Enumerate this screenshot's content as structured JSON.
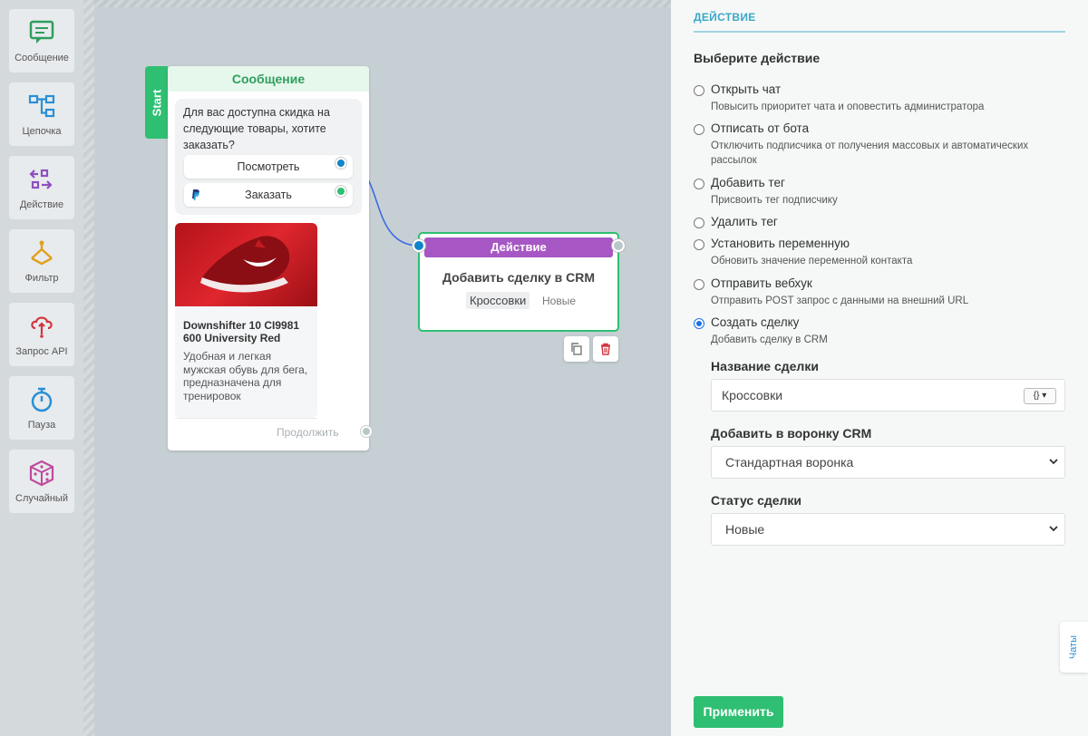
{
  "toolbar": {
    "items": [
      {
        "label": "Сообщение",
        "icon": "message-icon"
      },
      {
        "label": "Цепочка",
        "icon": "chain-icon"
      },
      {
        "label": "Действие",
        "icon": "action-icon"
      },
      {
        "label": "Фильтр",
        "icon": "filter-icon"
      },
      {
        "label": "Запрос API",
        "icon": "api-request-icon"
      },
      {
        "label": "Пауза",
        "icon": "pause-timer-icon"
      },
      {
        "label": "Случайный",
        "icon": "dice-icon"
      }
    ]
  },
  "message_node": {
    "start_label": "Start",
    "title": "Сообщение",
    "text": "Для вас доступна скидка на следующие товары, хотите заказать?",
    "buttons": [
      {
        "label": "Посмотреть"
      },
      {
        "label": "Заказать"
      }
    ],
    "card": {
      "title": "Downshifter 10 CI9981 600 University Red",
      "description": "Удобная и легкая мужская обувь для бега, предназначена для тренировок"
    },
    "continue_label": "Продолжить"
  },
  "action_node": {
    "header": "Действие",
    "title": "Добавить сделку в CRM",
    "deal_name": "Кроссовки",
    "status": "Новые"
  },
  "panel": {
    "header": "ДЕЙСТВИЕ",
    "section_title": "Выберите действие",
    "options": [
      {
        "title": "Открыть чат",
        "desc": "Повысить приоритет чата и оповестить администратора",
        "selected": false
      },
      {
        "title": "Отписать от бота",
        "desc": "Отключить подписчика от получения массовых и автоматических рассылок",
        "selected": false
      },
      {
        "title": "Добавить тег",
        "desc": "Присвоить тег подписчику",
        "selected": false
      },
      {
        "title": "Удалить тег",
        "desc": "",
        "selected": false
      },
      {
        "title": "Установить переменную",
        "desc": "Обновить значение переменной контакта",
        "selected": false
      },
      {
        "title": "Отправить вебхук",
        "desc": "Отправить POST запрос с данными на внешний URL",
        "selected": false
      },
      {
        "title": "Создать сделку",
        "desc": "Добавить сделку в CRM",
        "selected": true
      }
    ],
    "deal_name_label": "Название сделки",
    "deal_name_value": "Кроссовки",
    "var_button": "{}",
    "funnel_label": "Добавить в воронку CRM",
    "funnel_value": "Стандартная воронка",
    "status_label": "Статус сделки",
    "status_value": "Новые",
    "apply_label": "Применить",
    "chats_label": "Чаты"
  },
  "colors": {
    "green": "#2fbf72",
    "purple": "#a757c4",
    "blue_accent": "#3aa7c7"
  }
}
